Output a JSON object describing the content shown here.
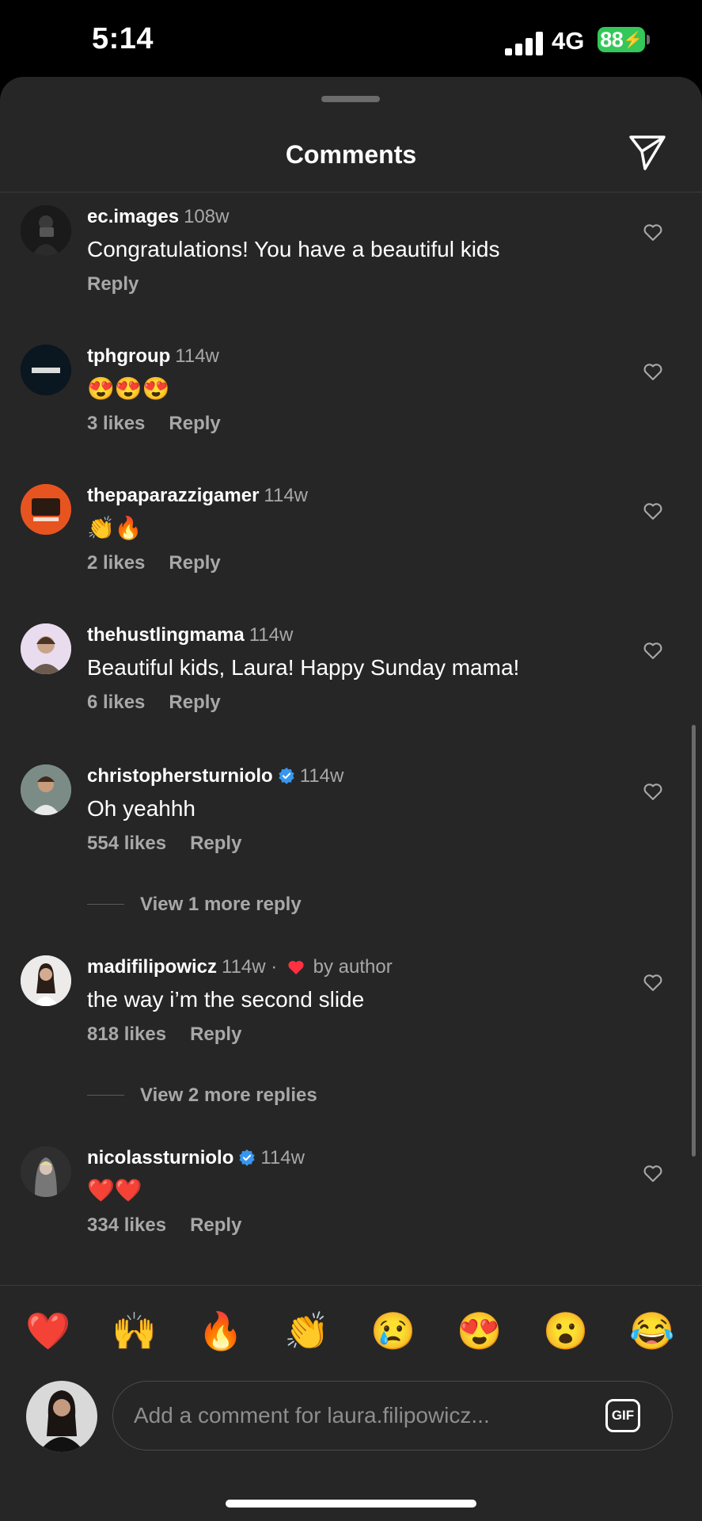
{
  "status_bar": {
    "time": "5:14",
    "network": "4G",
    "battery": "88"
  },
  "header": {
    "title": "Comments"
  },
  "comments": [
    {
      "user": "ec.images",
      "time": "108w",
      "text": "Congratulations! You have a beautiful kids",
      "likes": "",
      "reply": "Reply",
      "verified": false
    },
    {
      "user": "tphgroup",
      "time": "114w",
      "text": "😍😍😍",
      "likes": "3 likes",
      "reply": "Reply",
      "verified": false
    },
    {
      "user": "thepaparazzigamer",
      "time": "114w",
      "text": "👏🔥",
      "likes": "2 likes",
      "reply": "Reply",
      "verified": false
    },
    {
      "user": "thehustlingmama",
      "time": "114w",
      "text": "Beautiful kids, Laura! Happy Sunday mama!",
      "likes": "6 likes",
      "reply": "Reply",
      "verified": false
    },
    {
      "user": "christophersturniolo",
      "time": "114w",
      "text": "Oh yeahhh",
      "likes": "554 likes",
      "reply": "Reply",
      "verified": true,
      "view_replies": "View 1 more reply"
    },
    {
      "user": "madifilipowicz",
      "time": "114w ·",
      "liked_by": "by author",
      "text": "the way i’m the second slide",
      "likes": "818 likes",
      "reply": "Reply",
      "verified": false,
      "view_replies": "View 2 more replies"
    },
    {
      "user": "nicolassturniolo",
      "time": "114w",
      "text": "❤️❤️",
      "likes": "334 likes",
      "reply": "Reply",
      "verified": true
    }
  ],
  "emoji_bar": [
    "❤️",
    "🙌",
    "🔥",
    "👏",
    "😢",
    "😍",
    "😮",
    "😂"
  ],
  "composer": {
    "placeholder": "Add a comment for laura.filipowicz...",
    "gif_label": "GIF"
  },
  "colors": {
    "sheet_bg": "#262626",
    "muted_text": "#a8a8a8",
    "verified_blue": "#3797f0",
    "battery_green": "#34c759",
    "like_red": "#ff3040"
  }
}
